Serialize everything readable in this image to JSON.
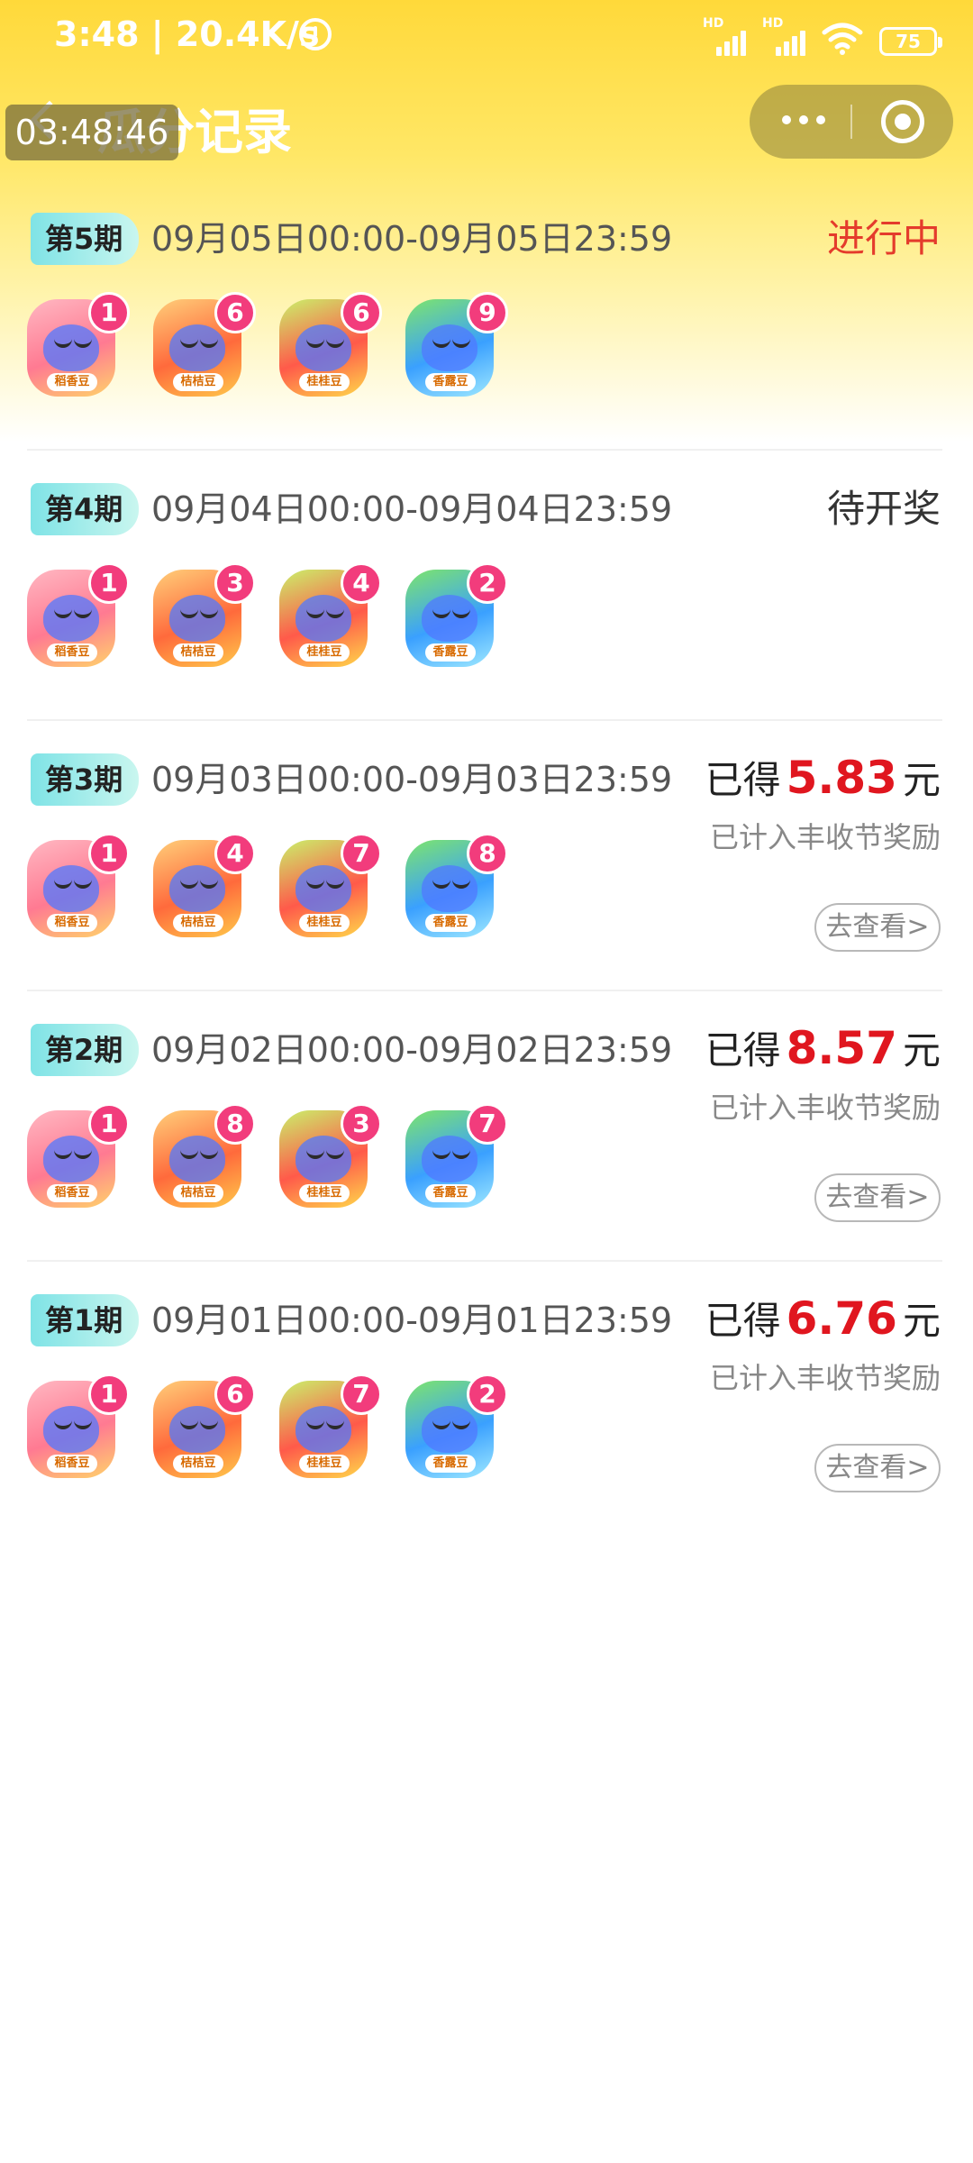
{
  "status_bar": {
    "time": "3:48 | 20.4K/s",
    "network_hd_1": "HD",
    "network_hd_2": "HD",
    "battery": "75"
  },
  "nav": {
    "title": "瓜分记录",
    "timer": "03:48:46"
  },
  "card_labels": [
    "稻香豆",
    "桔桔豆",
    "桂桂豆",
    "香露豆"
  ],
  "records": [
    {
      "period": "第5期",
      "range": "09月05日00:00-09月05日23:59",
      "status": "进行中",
      "counts": [
        "1",
        "6",
        "6",
        "9"
      ]
    },
    {
      "period": "第4期",
      "range": "09月04日00:00-09月04日23:59",
      "status": "待开奖",
      "counts": [
        "1",
        "3",
        "4",
        "2"
      ]
    },
    {
      "period": "第3期",
      "range": "09月03日00:00-09月03日23:59",
      "earned_prefix": "已得",
      "earned_amount": "5.83",
      "earned_unit": "元",
      "note": "已计入丰收节奖励",
      "view_label": "去查看>",
      "counts": [
        "1",
        "4",
        "7",
        "8"
      ]
    },
    {
      "period": "第2期",
      "range": "09月02日00:00-09月02日23:59",
      "earned_prefix": "已得",
      "earned_amount": "8.57",
      "earned_unit": "元",
      "note": "已计入丰收节奖励",
      "view_label": "去查看>",
      "counts": [
        "1",
        "8",
        "3",
        "7"
      ]
    },
    {
      "period": "第1期",
      "range": "09月01日00:00-09月01日23:59",
      "earned_prefix": "已得",
      "earned_amount": "6.76",
      "earned_unit": "元",
      "note": "已计入丰收节奖励",
      "view_label": "去查看>",
      "counts": [
        "1",
        "6",
        "7",
        "2"
      ]
    }
  ],
  "colors": {
    "active_status": "#e43b2c",
    "amount": "#e0161f",
    "badge_cyan": "#7fe3e6",
    "count_pink": "#f23c7c"
  }
}
